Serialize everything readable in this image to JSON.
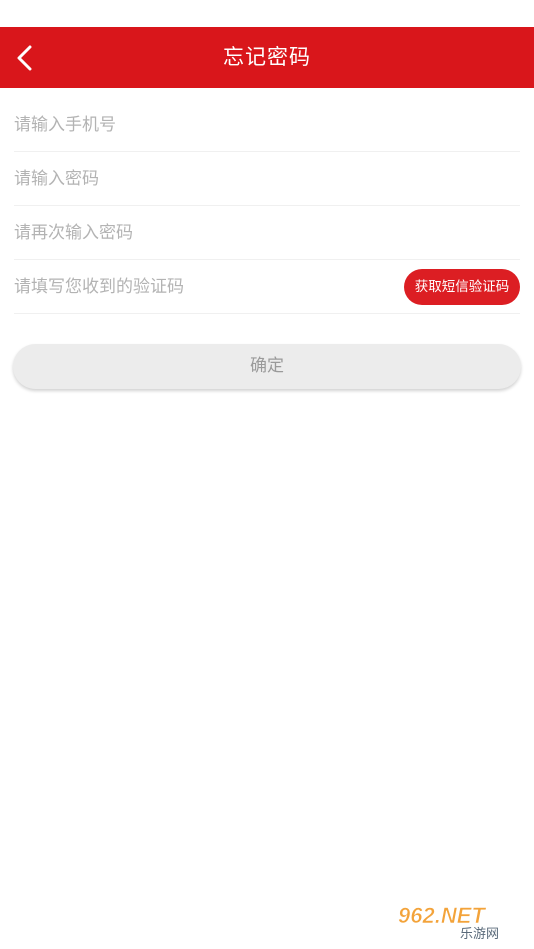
{
  "header": {
    "title": "忘记密码",
    "back_icon": "chevron-left-icon"
  },
  "form": {
    "phone_placeholder": "请输入手机号",
    "password_placeholder": "请输入密码",
    "password_confirm_placeholder": "请再次输入密码",
    "code_placeholder": "请填写您收到的验证码",
    "sms_button_label": "获取短信验证码"
  },
  "confirm_label": "确定",
  "watermark": {
    "text": "962.NET",
    "subtext": "乐游网"
  },
  "colors": {
    "brand_red": "#d9161b",
    "button_red": "#dc1e23",
    "placeholder_gray": "#b3b3b3",
    "confirm_bg": "#ececec"
  }
}
